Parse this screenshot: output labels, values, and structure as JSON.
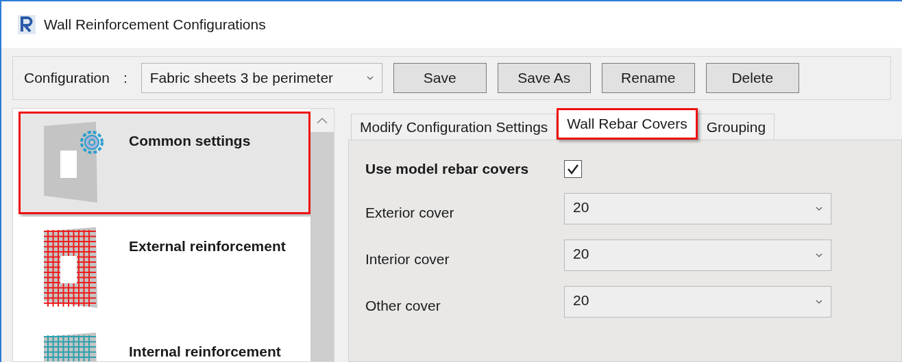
{
  "window": {
    "title": "Wall Reinforcement Configurations"
  },
  "toolbar": {
    "label": "Configuration",
    "separator": ":",
    "configuration": "Fabric sheets 3 be perimeter",
    "buttons": [
      "Save",
      "Save As",
      "Rename",
      "Delete"
    ]
  },
  "sidebar": {
    "items": [
      {
        "label": "Common settings",
        "kind": "common",
        "selected": true,
        "highlighted": true
      },
      {
        "label": "External reinforcement",
        "kind": "external",
        "selected": false,
        "highlighted": false
      },
      {
        "label": "Internal reinforcement",
        "kind": "internal",
        "selected": false,
        "highlighted": false
      }
    ]
  },
  "tabs": [
    {
      "label": "Modify Configuration Settings",
      "selected": false,
      "highlighted": false
    },
    {
      "label": "Wall Rebar Covers",
      "selected": true,
      "highlighted": true
    },
    {
      "label": "Grouping",
      "selected": false,
      "highlighted": false
    }
  ],
  "covers": {
    "use_model_label": "Use model rebar covers",
    "use_model_checked": true,
    "fields": [
      {
        "label": "Exterior cover",
        "value": "20"
      },
      {
        "label": "Interior cover",
        "value": "20"
      },
      {
        "label": "Other cover",
        "value": "20"
      }
    ]
  }
}
